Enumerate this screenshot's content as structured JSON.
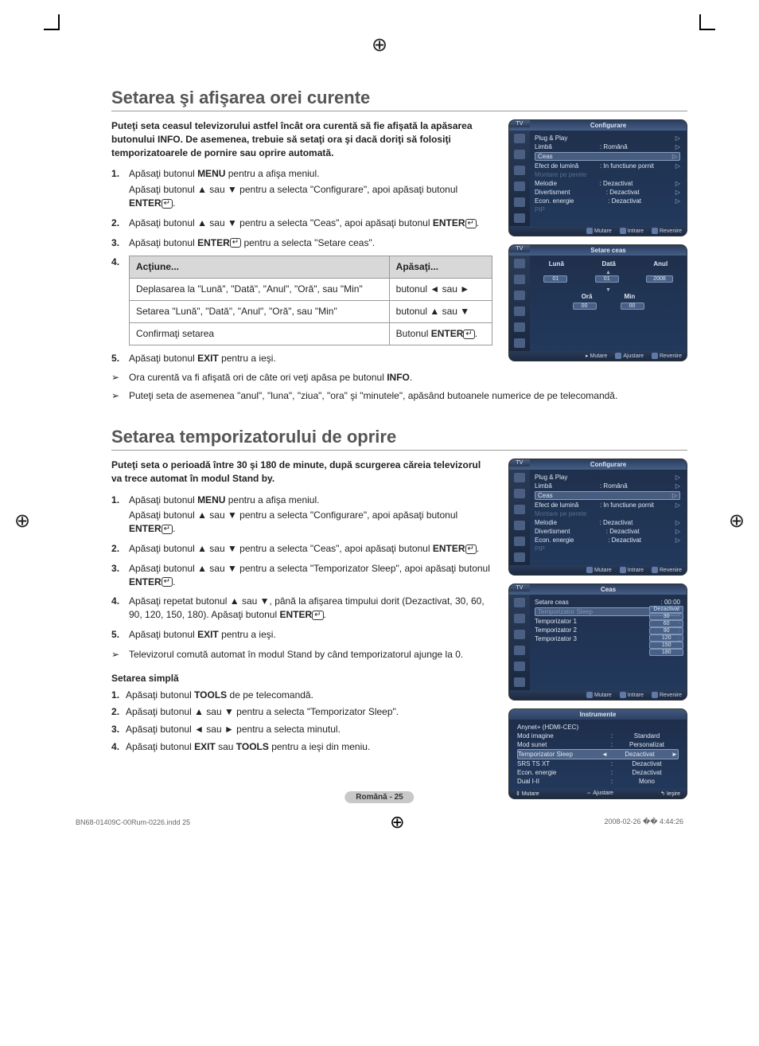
{
  "page": {
    "title1": "Setarea şi afişarea orei curente",
    "intro1": "Puteţi seta ceasul televizorului astfel încât ora curentă să fie afişată la apăsarea butonului INFO. De asemenea, trebuie să setaţi ora şi dacă doriţi să folosiţi temporizatoarele de pornire sau oprire automată.",
    "title2": "Setarea temporizatorului de oprire",
    "intro2": "Puteţi seta o perioadă între 30 şi 180 de minute, după scurgerea căreia televizorul va trece automat în modul Stand by.",
    "subhead_simple": "Setarea simplă",
    "footer_pill": "Română - 25",
    "print_left": "BN68-01409C-00Rum-0226.indd   25",
    "print_right": "2008-02-26   �� 4:44:26"
  },
  "steps1": {
    "s1a": "Apăsaţi butonul ",
    "s1a_b": "MENU",
    "s1a_end": " pentru a afişa meniul.",
    "s1b": "Apăsaţi butonul ▲ sau ▼ pentru a selecta \"Configurare\", apoi apăsaţi butonul ",
    "s1b_b": "ENTER",
    "s2": "Apăsaţi butonul ▲ sau ▼ pentru a selecta \"Ceas\", apoi apăsaţi butonul ",
    "s2_b": "ENTER",
    "s3": "Apăsaţi butonul ",
    "s3_b": "ENTER",
    "s3_end": " pentru a selecta \"Setare ceas\".",
    "s5": "Apăsaţi butonul ",
    "s5_b": "EXIT",
    "s5_end": " pentru a ieşi.",
    "note1_a": "Ora curentă va fi afişată ori de câte ori veţi apăsa pe butonul ",
    "note1_b": "INFO",
    "note2": "Puteţi seta de asemenea \"anul\", \"luna\", \"ziua\", \"ora\" şi \"minutele\", apăsând butoanele numerice de pe telecomandă."
  },
  "actiontable": {
    "h1": "Acţiune...",
    "h2": "Apăsaţi...",
    "r1c1": "Deplasarea la \"Lună\", \"Dată\", \"Anul\", \"Oră\", sau \"Min\"",
    "r1c2": "butonul ◄ sau ►",
    "r2c1": "Setarea \"Lună\", \"Dată\", \"Anul\", \"Oră\", sau \"Min\"",
    "r2c2": "butonul ▲ sau ▼",
    "r3c1": "Confirmaţi setarea",
    "r3c2a": "Butonul ",
    "r3c2b": "ENTER"
  },
  "steps2": {
    "s1a": "Apăsaţi butonul ",
    "s1a_b": "MENU",
    "s1a_end": " pentru a afişa meniul.",
    "s1b": "Apăsaţi butonul ▲ sau ▼ pentru a selecta \"Configurare\", apoi apăsaţi butonul ",
    "s1b_b": "ENTER",
    "s2": "Apăsaţi butonul ▲ sau ▼ pentru a selecta \"Ceas\", apoi apăsaţi butonul ",
    "s2_b": "ENTER",
    "s3": "Apăsaţi butonul ▲ sau ▼ pentru a selecta \"Temporizator Sleep\", apoi apăsaţi butonul ",
    "s3_b": "ENTER",
    "s4": "Apăsaţi repetat butonul ▲ sau ▼, până la afişarea timpului dorit (Dezactivat, 30, 60, 90, 120, 150, 180). Apăsaţi butonul ",
    "s4_b": "ENTER",
    "s5": "Apăsaţi butonul ",
    "s5_b": "EXIT",
    "s5_end": " pentru a ieşi.",
    "note1": "Televizorul comută automat în modul Stand by când temporizatorul ajunge la 0."
  },
  "simple": {
    "s1": "Apăsaţi butonul ",
    "s1_b": "TOOLS",
    "s1_end": " de pe telecomandă.",
    "s2": "Apăsaţi butonul ▲ sau ▼ pentru a selecta \"Temporizator Sleep\".",
    "s3": "Apăsaţi butonul ◄ sau ► pentru a selecta minutul.",
    "s4a": "Apăsaţi butonul ",
    "s4b": "EXIT",
    "s4c": " sau ",
    "s4d": "TOOLS",
    "s4e": " pentru a ieşi din meniu."
  },
  "osd_config": {
    "tv": "TV",
    "title": "Configurare",
    "plug": "Plug & Play",
    "limba": "Limbă",
    "limba_v": ": Română",
    "ceas": "Ceas",
    "efect": "Efect de lumină",
    "efect_v": ": In functiune pornit",
    "montare": "Montare pe perete",
    "melodie": "Melodie",
    "melodie_v": ": Dezactivat",
    "divert": "Divertisment",
    "divert_v": ": Dezactivat",
    "econ": "Econ. energie",
    "econ_v": ": Dezactivat",
    "pip": "PIP",
    "f_mutare": "Mutare",
    "f_intrare": "Intrare",
    "f_revenire": "Revenire"
  },
  "osd_setare": {
    "title": "Setare ceas",
    "luna": "Lună",
    "data": "Dată",
    "anul": "Anul",
    "ora": "Oră",
    "min": "Min",
    "v_luna": "01",
    "v_data": "01",
    "v_an": "2008",
    "v_ora": "00",
    "v_min": "00",
    "f_mutare": "Mutare",
    "f_ajustare": "Ajustare",
    "f_revenire": "Revenire"
  },
  "osd_ceas": {
    "title": "Ceas",
    "setare": "Setare ceas",
    "setare_v": ": 00:00",
    "sleep": "Temporizator Sleep",
    "t1": "Temporizator 1",
    "t2": "Temporizator 2",
    "t3": "Temporizator 3",
    "colon": ":",
    "opts": [
      "Dezactivat",
      "30",
      "60",
      "90",
      "120",
      "150",
      "180"
    ],
    "f_mutare": "Mutare",
    "f_intrare": "Intrare",
    "f_revenire": "Revenire"
  },
  "osd_tools": {
    "title": "Instrumente",
    "anynet": "Anynet+ (HDMI-CEC)",
    "modimg": "Mod imagine",
    "modimg_v": "Standard",
    "modsun": "Mod sunet",
    "modsun_v": "Personalizat",
    "sleep": "Temporizator Sleep",
    "sleep_v": "Dezactivat",
    "srs": "SRS TS XT",
    "srs_v": "Dezactivat",
    "econ": "Econ. energie",
    "econ_v": "Dezactivat",
    "dual": "Dual I-II",
    "dual_v": "Mono",
    "f_mutare": "Mutare",
    "f_ajustare": "Ajustare",
    "f_iesire": "Ieşire"
  }
}
